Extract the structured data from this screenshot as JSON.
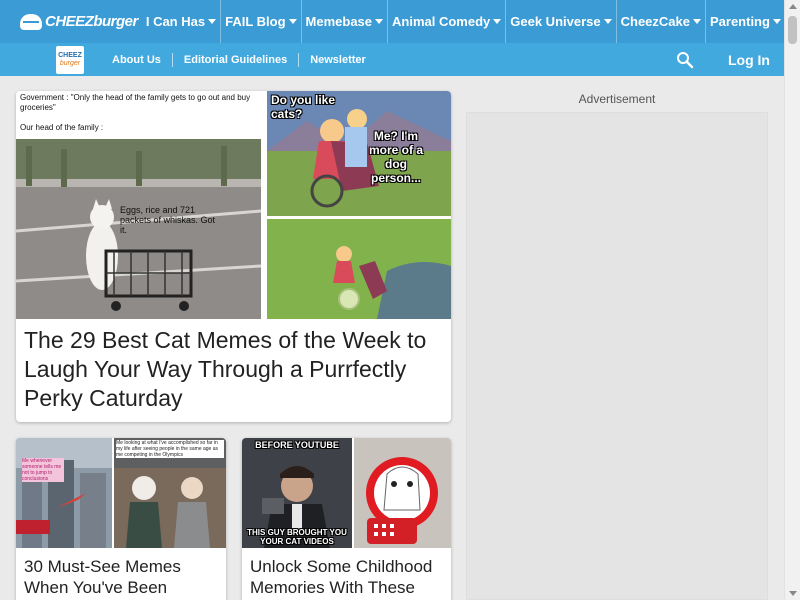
{
  "brand": {
    "logo_text": "CHEEZburger",
    "sub_logo_line1": "CHEEZ",
    "sub_logo_line2": "burger"
  },
  "topnav": {
    "items": [
      {
        "label": "I Can Has"
      },
      {
        "label": "FAIL Blog"
      },
      {
        "label": "Memebase"
      },
      {
        "label": "Animal Comedy"
      },
      {
        "label": "Geek Universe"
      },
      {
        "label": "CheezCake"
      },
      {
        "label": "Parenting"
      }
    ]
  },
  "subnav": {
    "links": [
      "About Us",
      "Editorial Guidelines",
      "Newsletter"
    ],
    "login_label": "Log In"
  },
  "feature": {
    "title": "The 29 Best Cat Memes of the Week to Laugh Your Way Through a Purrfectly Perky Caturday",
    "meme_left": {
      "line1": "Government : \"Only the head of the family gets to go out and buy groceries\"",
      "line2": "Our head of the family :",
      "cart_caption": "Eggs, rice and 721 packets of whiskas. Got it."
    },
    "meme_right": {
      "bubble1": "Do you like cats?",
      "bubble2": "Me? I'm more of a dog person..."
    }
  },
  "cards": [
    {
      "title": "30 Must-See Memes When You've Been",
      "meme_text": "Me looking at what I've accomplished so far in my life after seeing people in the same age as me competing in the Olympics",
      "inset_text": "Me whenever someone tells me not to jump to conclusions"
    },
    {
      "title": "Unlock Some Childhood Memories With These",
      "caption_top": "BEFORE YOUTUBE",
      "caption_bottom": "THIS GUY BROUGHT YOU YOUR CAT VIDEOS"
    }
  ],
  "ad": {
    "label": "Advertisement"
  },
  "colors": {
    "topnav_bg": "#3a9bd5",
    "subnav_bg": "#41a9dd",
    "page_bg": "#eaeaea"
  }
}
